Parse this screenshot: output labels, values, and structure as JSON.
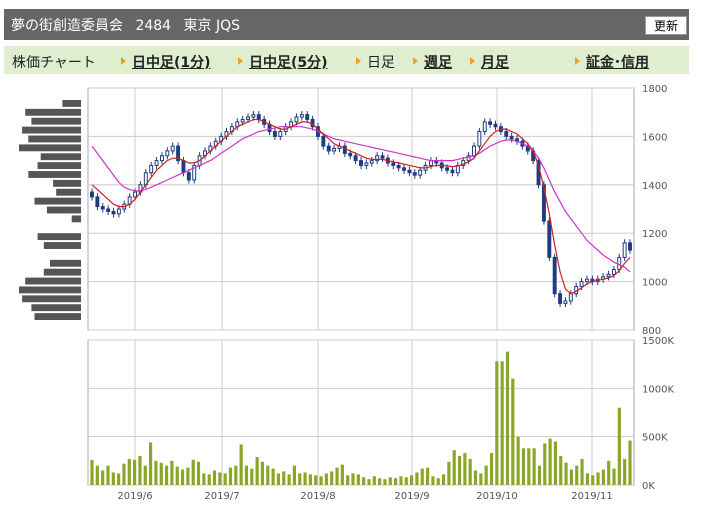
{
  "header": {
    "company": "夢の街創造委員会",
    "code": "2484",
    "market": "東京 JQS",
    "refresh_label": "更新"
  },
  "tabs": [
    {
      "label": "株価チャート",
      "link": false
    },
    {
      "label": "日中足(1分)",
      "link": true
    },
    {
      "label": "日中足(5分)",
      "link": true
    },
    {
      "label": "日足",
      "link": false
    },
    {
      "label": "週足",
      "link": true
    },
    {
      "label": "月足",
      "link": true
    },
    {
      "label": "証金･信用",
      "link": true
    }
  ],
  "colors": {
    "up": "#ffffff",
    "down": "#1f3c80",
    "ma_short": "#cc2222",
    "ma_long": "#cc33cc",
    "volume": "#8aa626",
    "volume_profile": "#555555",
    "grid": "#cccccc",
    "header": "#666666",
    "tabbar": "#e0eed0",
    "arrow": "#f0a020"
  },
  "chart_data": [
    {
      "type": "candlestick",
      "x_labels": [
        "2019/6",
        "2019/7",
        "2019/8",
        "2019/9",
        "2019/10",
        "2019/11"
      ],
      "y_ticks": [
        800,
        1000,
        1200,
        1400,
        1600,
        1800
      ],
      "ylim": [
        800,
        1800
      ],
      "grid": true,
      "approx_close": [
        1350,
        1310,
        1300,
        1290,
        1280,
        1300,
        1320,
        1350,
        1370,
        1400,
        1450,
        1480,
        1500,
        1520,
        1540,
        1560,
        1500,
        1450,
        1420,
        1480,
        1520,
        1540,
        1560,
        1580,
        1600,
        1620,
        1640,
        1660,
        1670,
        1680,
        1690,
        1670,
        1650,
        1620,
        1600,
        1620,
        1640,
        1660,
        1680,
        1690,
        1670,
        1640,
        1600,
        1560,
        1540,
        1550,
        1560,
        1530,
        1520,
        1500,
        1480,
        1490,
        1500,
        1520,
        1510,
        1490,
        1480,
        1470,
        1460,
        1450,
        1440,
        1460,
        1480,
        1500,
        1490,
        1470,
        1460,
        1450,
        1480,
        1500,
        1520,
        1560,
        1620,
        1660,
        1650,
        1640,
        1620,
        1600,
        1590,
        1580,
        1560,
        1540,
        1500,
        1400,
        1250,
        1100,
        950,
        910,
        920,
        950,
        980,
        1000,
        1010,
        1000,
        1010,
        1020,
        1030,
        1050,
        1100,
        1160,
        1130
      ],
      "ma_short": [
        1400,
        1380,
        1360,
        1340,
        1320,
        1310,
        1310,
        1320,
        1340,
        1370,
        1400,
        1430,
        1460,
        1480,
        1500,
        1510,
        1510,
        1500,
        1490,
        1490,
        1500,
        1520,
        1540,
        1560,
        1580,
        1600,
        1620,
        1640,
        1650,
        1660,
        1670,
        1670,
        1660,
        1650,
        1640,
        1630,
        1630,
        1640,
        1650,
        1660,
        1660,
        1650,
        1630,
        1610,
        1590,
        1570,
        1560,
        1550,
        1540,
        1530,
        1520,
        1510,
        1505,
        1505,
        1505,
        1500,
        1495,
        1490,
        1485,
        1480,
        1475,
        1470,
        1470,
        1475,
        1480,
        1480,
        1478,
        1475,
        1478,
        1485,
        1495,
        1510,
        1540,
        1570,
        1600,
        1620,
        1630,
        1630,
        1620,
        1610,
        1590,
        1570,
        1540,
        1480,
        1390,
        1280,
        1150,
        1040,
        970,
        950,
        960,
        975,
        990,
        1000,
        1005,
        1010,
        1015,
        1025,
        1045,
        1075,
        1100
      ],
      "ma_long": [
        1560,
        1530,
        1500,
        1470,
        1440,
        1410,
        1390,
        1380,
        1375,
        1375,
        1380,
        1390,
        1400,
        1410,
        1420,
        1430,
        1440,
        1450,
        1460,
        1470,
        1480,
        1490,
        1500,
        1515,
        1530,
        1545,
        1560,
        1575,
        1590,
        1600,
        1610,
        1620,
        1625,
        1630,
        1635,
        1640,
        1640,
        1640,
        1640,
        1640,
        1635,
        1630,
        1620,
        1610,
        1600,
        1590,
        1585,
        1580,
        1575,
        1570,
        1565,
        1560,
        1555,
        1550,
        1545,
        1540,
        1535,
        1530,
        1525,
        1520,
        1515,
        1510,
        1505,
        1500,
        1500,
        1500,
        1500,
        1500,
        1505,
        1510,
        1515,
        1520,
        1530,
        1545,
        1560,
        1570,
        1580,
        1585,
        1585,
        1580,
        1570,
        1560,
        1540,
        1510,
        1470,
        1420,
        1370,
        1330,
        1290,
        1260,
        1230,
        1200,
        1170,
        1150,
        1130,
        1110,
        1095,
        1080,
        1070,
        1060,
        1040
      ],
      "volume_profile_relative": [
        0.3,
        0.9,
        0.8,
        0.95,
        0.85,
        1.0,
        0.65,
        0.7,
        0.85,
        0.45,
        0.4,
        0.75,
        0.55,
        0.15,
        0.0,
        0.7,
        0.6,
        0.0,
        0.5,
        0.6,
        0.9,
        1.0,
        0.95,
        0.8,
        0.75
      ]
    },
    {
      "type": "bar",
      "x_labels": [
        "2019/6",
        "2019/7",
        "2019/8",
        "2019/9",
        "2019/10",
        "2019/11"
      ],
      "y_ticks": [
        "0K",
        "500K",
        "1000K",
        "1500K"
      ],
      "ylim": [
        0,
        1500000
      ],
      "values": [
        260000,
        200000,
        150000,
        200000,
        130000,
        120000,
        220000,
        270000,
        260000,
        300000,
        200000,
        440000,
        250000,
        230000,
        200000,
        250000,
        190000,
        160000,
        180000,
        260000,
        240000,
        120000,
        110000,
        150000,
        130000,
        120000,
        180000,
        200000,
        420000,
        200000,
        170000,
        290000,
        240000,
        200000,
        170000,
        120000,
        140000,
        110000,
        200000,
        120000,
        130000,
        110000,
        100000,
        90000,
        120000,
        140000,
        180000,
        210000,
        100000,
        120000,
        110000,
        80000,
        60000,
        90000,
        70000,
        60000,
        80000,
        70000,
        90000,
        80000,
        100000,
        130000,
        170000,
        180000,
        90000,
        70000,
        110000,
        240000,
        360000,
        300000,
        330000,
        270000,
        150000,
        120000,
        200000,
        330000,
        1280000,
        1280000,
        1380000,
        1100000,
        500000,
        380000,
        380000,
        380000,
        200000,
        430000,
        480000,
        450000,
        300000,
        230000,
        160000,
        200000,
        270000,
        120000,
        100000,
        130000,
        160000,
        250000,
        170000,
        800000,
        270000,
        460000
      ]
    }
  ]
}
